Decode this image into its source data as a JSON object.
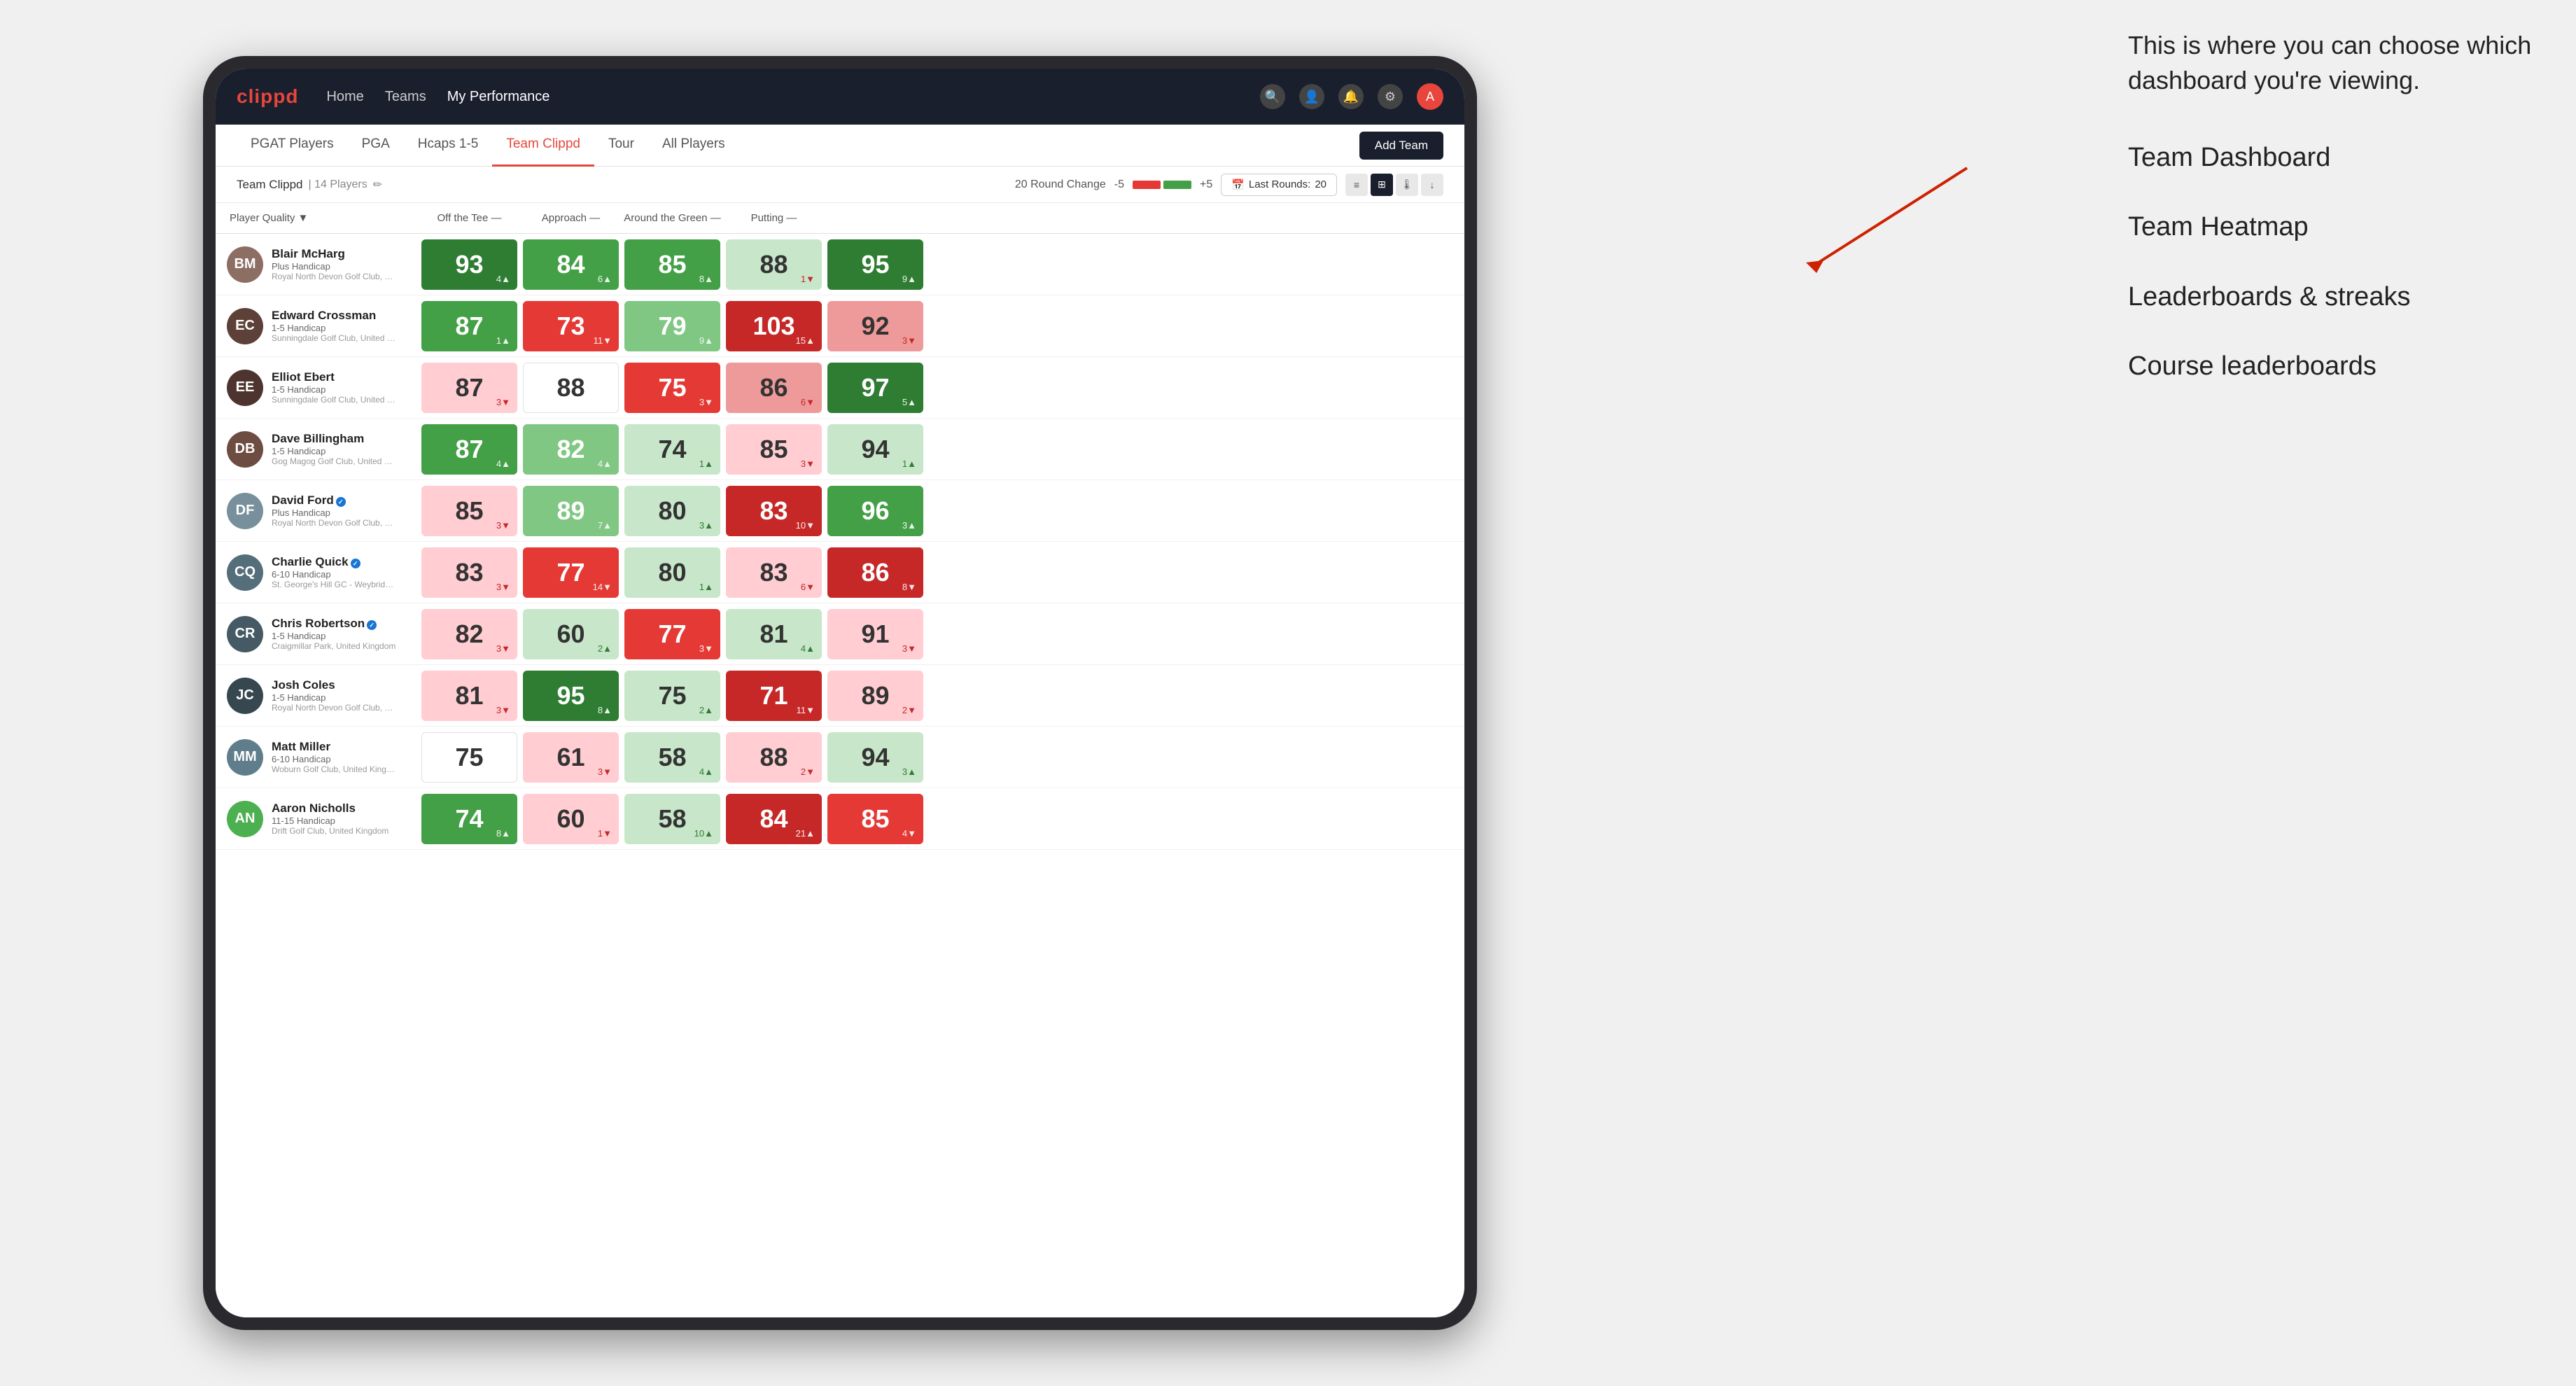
{
  "annotation": {
    "intro": "This is where you can choose which dashboard you're viewing.",
    "options": [
      "Team Dashboard",
      "Team Heatmap",
      "Leaderboards & streaks",
      "Course leaderboards"
    ]
  },
  "nav": {
    "logo": "clippd",
    "items": [
      "Home",
      "Teams",
      "My Performance"
    ],
    "active": "My Performance"
  },
  "sub_nav": {
    "items": [
      "PGAT Players",
      "PGA",
      "Hcaps 1-5",
      "Team Clippd",
      "Tour",
      "All Players"
    ],
    "active": "Team Clippd",
    "add_team": "Add Team"
  },
  "team_header": {
    "name": "Team Clippd",
    "separator": "|",
    "count": "14 Players",
    "round_change_label": "20 Round Change",
    "range_min": "-5",
    "range_max": "+5",
    "last_rounds_label": "Last Rounds:",
    "last_rounds_value": "20"
  },
  "table": {
    "columns": [
      {
        "label": "Player Quality",
        "arrow": "▼",
        "key": "player_quality"
      },
      {
        "label": "Off the Tee",
        "arrow": "—",
        "key": "off_tee"
      },
      {
        "label": "Approach",
        "arrow": "—",
        "key": "approach"
      },
      {
        "label": "Around the Green",
        "arrow": "—",
        "key": "around_green"
      },
      {
        "label": "Putting",
        "arrow": "—",
        "key": "putting"
      }
    ],
    "rows": [
      {
        "name": "Blair McHarg",
        "handicap": "Plus Handicap",
        "club": "Royal North Devon Golf Club, United Kingdom",
        "initials": "BM",
        "avatar_color": "#8d6e63",
        "player_quality": {
          "value": "93",
          "change": "4",
          "dir": "up",
          "bg": "green-dark"
        },
        "off_tee": {
          "value": "84",
          "change": "6",
          "dir": "up",
          "bg": "green-mid"
        },
        "approach": {
          "value": "85",
          "change": "8",
          "dir": "up",
          "bg": "green-mid"
        },
        "around_green": {
          "value": "88",
          "change": "1",
          "dir": "down",
          "bg": "green-pale"
        },
        "putting": {
          "value": "95",
          "change": "9",
          "dir": "up",
          "bg": "green-dark"
        }
      },
      {
        "name": "Edward Crossman",
        "handicap": "1-5 Handicap",
        "club": "Sunningdale Golf Club, United Kingdom",
        "initials": "EC",
        "avatar_color": "#5d4037",
        "player_quality": {
          "value": "87",
          "change": "1",
          "dir": "up",
          "bg": "green-mid"
        },
        "off_tee": {
          "value": "73",
          "change": "11",
          "dir": "down",
          "bg": "red-mid"
        },
        "approach": {
          "value": "79",
          "change": "9",
          "dir": "up",
          "bg": "green-light"
        },
        "around_green": {
          "value": "103",
          "change": "15",
          "dir": "up",
          "bg": "red-dark"
        },
        "putting": {
          "value": "92",
          "change": "3",
          "dir": "down",
          "bg": "red-light"
        }
      },
      {
        "name": "Elliot Ebert",
        "handicap": "1-5 Handicap",
        "club": "Sunningdale Golf Club, United Kingdom",
        "initials": "EE",
        "avatar_color": "#4e342e",
        "player_quality": {
          "value": "87",
          "change": "3",
          "dir": "down",
          "bg": "red-pale"
        },
        "off_tee": {
          "value": "88",
          "change": "",
          "dir": "neutral",
          "bg": "white"
        },
        "approach": {
          "value": "75",
          "change": "3",
          "dir": "down",
          "bg": "red-mid"
        },
        "around_green": {
          "value": "86",
          "change": "6",
          "dir": "down",
          "bg": "red-light"
        },
        "putting": {
          "value": "97",
          "change": "5",
          "dir": "up",
          "bg": "green-dark"
        }
      },
      {
        "name": "Dave Billingham",
        "handicap": "1-5 Handicap",
        "club": "Gog Magog Golf Club, United Kingdom",
        "initials": "DB",
        "avatar_color": "#6d4c41",
        "player_quality": {
          "value": "87",
          "change": "4",
          "dir": "up",
          "bg": "green-mid"
        },
        "off_tee": {
          "value": "82",
          "change": "4",
          "dir": "up",
          "bg": "green-light"
        },
        "approach": {
          "value": "74",
          "change": "1",
          "dir": "up",
          "bg": "green-pale"
        },
        "around_green": {
          "value": "85",
          "change": "3",
          "dir": "down",
          "bg": "red-pale"
        },
        "putting": {
          "value": "94",
          "change": "1",
          "dir": "up",
          "bg": "green-pale"
        }
      },
      {
        "name": "David Ford",
        "handicap": "Plus Handicap",
        "club": "Royal North Devon Golf Club, United Kingdom",
        "initials": "DF",
        "avatar_color": "#78909c",
        "verified": true,
        "player_quality": {
          "value": "85",
          "change": "3",
          "dir": "down",
          "bg": "red-pale"
        },
        "off_tee": {
          "value": "89",
          "change": "7",
          "dir": "up",
          "bg": "green-light"
        },
        "approach": {
          "value": "80",
          "change": "3",
          "dir": "up",
          "bg": "green-pale"
        },
        "around_green": {
          "value": "83",
          "change": "10",
          "dir": "down",
          "bg": "red-dark"
        },
        "putting": {
          "value": "96",
          "change": "3",
          "dir": "up",
          "bg": "green-mid"
        }
      },
      {
        "name": "Charlie Quick",
        "handicap": "6-10 Handicap",
        "club": "St. George's Hill GC - Weybridge - Surrey, Uni...",
        "initials": "CQ",
        "avatar_color": "#546e7a",
        "verified": true,
        "player_quality": {
          "value": "83",
          "change": "3",
          "dir": "down",
          "bg": "red-pale"
        },
        "off_tee": {
          "value": "77",
          "change": "14",
          "dir": "down",
          "bg": "red-mid"
        },
        "approach": {
          "value": "80",
          "change": "1",
          "dir": "up",
          "bg": "green-pale"
        },
        "around_green": {
          "value": "83",
          "change": "6",
          "dir": "down",
          "bg": "red-pale"
        },
        "putting": {
          "value": "86",
          "change": "8",
          "dir": "down",
          "bg": "red-dark"
        }
      },
      {
        "name": "Chris Robertson",
        "handicap": "1-5 Handicap",
        "club": "Craigmillar Park, United Kingdom",
        "initials": "CR",
        "avatar_color": "#455a64",
        "verified": true,
        "player_quality": {
          "value": "82",
          "change": "3",
          "dir": "down",
          "bg": "red-pale"
        },
        "off_tee": {
          "value": "60",
          "change": "2",
          "dir": "up",
          "bg": "green-pale"
        },
        "approach": {
          "value": "77",
          "change": "3",
          "dir": "down",
          "bg": "red-mid"
        },
        "around_green": {
          "value": "81",
          "change": "4",
          "dir": "up",
          "bg": "green-pale"
        },
        "putting": {
          "value": "91",
          "change": "3",
          "dir": "down",
          "bg": "red-pale"
        }
      },
      {
        "name": "Josh Coles",
        "handicap": "1-5 Handicap",
        "club": "Royal North Devon Golf Club, United Kingdom",
        "initials": "JC",
        "avatar_color": "#37474f",
        "player_quality": {
          "value": "81",
          "change": "3",
          "dir": "down",
          "bg": "red-pale"
        },
        "off_tee": {
          "value": "95",
          "change": "8",
          "dir": "up",
          "bg": "green-dark"
        },
        "approach": {
          "value": "75",
          "change": "2",
          "dir": "up",
          "bg": "green-pale"
        },
        "around_green": {
          "value": "71",
          "change": "11",
          "dir": "down",
          "bg": "red-dark"
        },
        "putting": {
          "value": "89",
          "change": "2",
          "dir": "down",
          "bg": "red-pale"
        }
      },
      {
        "name": "Matt Miller",
        "handicap": "6-10 Handicap",
        "club": "Woburn Golf Club, United Kingdom",
        "initials": "MM",
        "avatar_color": "#607d8b",
        "player_quality": {
          "value": "75",
          "change": "",
          "dir": "neutral",
          "bg": "white"
        },
        "off_tee": {
          "value": "61",
          "change": "3",
          "dir": "down",
          "bg": "red-pale"
        },
        "approach": {
          "value": "58",
          "change": "4",
          "dir": "up",
          "bg": "green-pale"
        },
        "around_green": {
          "value": "88",
          "change": "2",
          "dir": "down",
          "bg": "red-pale"
        },
        "putting": {
          "value": "94",
          "change": "3",
          "dir": "up",
          "bg": "green-pale"
        }
      },
      {
        "name": "Aaron Nicholls",
        "handicap": "11-15 Handicap",
        "club": "Drift Golf Club, United Kingdom",
        "initials": "AN",
        "avatar_color": "#4caf50",
        "player_quality": {
          "value": "74",
          "change": "8",
          "dir": "up",
          "bg": "green-mid"
        },
        "off_tee": {
          "value": "60",
          "change": "1",
          "dir": "down",
          "bg": "red-pale"
        },
        "approach": {
          "value": "58",
          "change": "10",
          "dir": "up",
          "bg": "green-pale"
        },
        "around_green": {
          "value": "84",
          "change": "21",
          "dir": "up",
          "bg": "red-dark"
        },
        "putting": {
          "value": "85",
          "change": "4",
          "dir": "down",
          "bg": "red-mid"
        }
      }
    ]
  }
}
